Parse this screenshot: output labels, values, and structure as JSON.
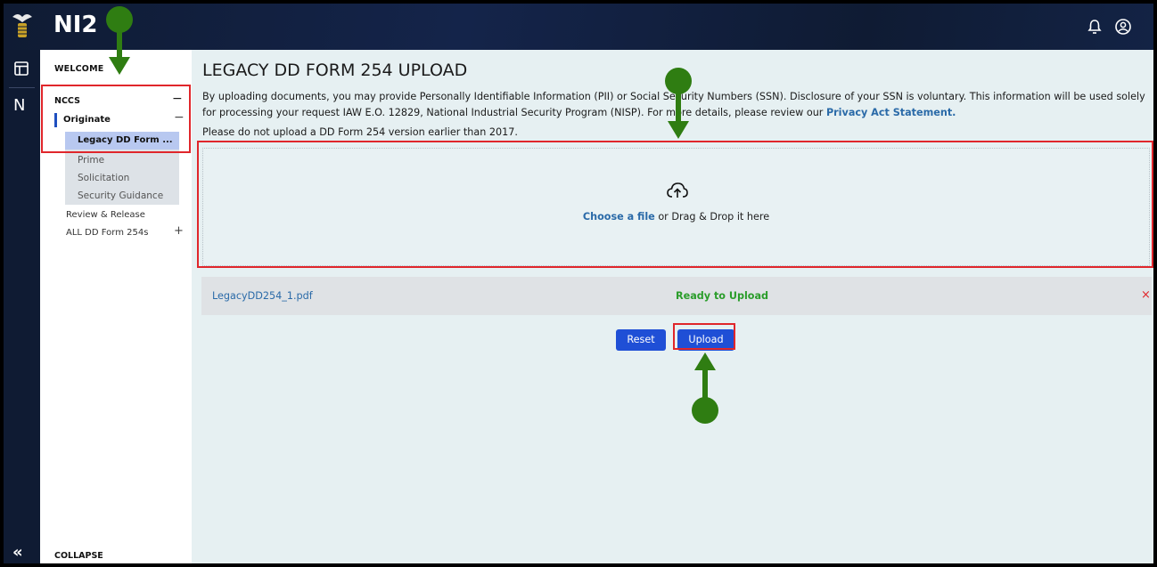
{
  "app": {
    "brand": "NI2"
  },
  "rail": {
    "collapse_glyph": "«",
    "n_label": "N"
  },
  "menu": {
    "welcome": "WELCOME",
    "nccs": "NCCS",
    "nccs_toggle": "−",
    "originate": "Originate",
    "originate_toggle": "−",
    "legacy": "Legacy DD Form ...",
    "sub_items": [
      "Prime",
      "Solicitation",
      "Security Guidance"
    ],
    "review": "Review & Release",
    "all_dd": "ALL DD Form 254s",
    "all_dd_toggle": "+",
    "collapse": "COLLAPSE"
  },
  "main": {
    "title": "LEGACY DD FORM 254 UPLOAD",
    "desc_text": "By uploading documents, you may provide Personally Identifiable Information (PII) or Social Security Numbers (SSN). Disclosure of your SSN is voluntary. This information will be used solely for processing your request IAW E.O. 12829, National Industrial Security Program (NISP). For more details, please review our ",
    "desc_link": "Privacy Act Statement.",
    "note": "Please do not upload a DD Form 254 version earlier than 2017.",
    "dropzone_choose": "Choose a file",
    "dropzone_rest": " or Drag & Drop it here",
    "file_name": "LegacyDD254_1.pdf",
    "file_status": "Ready to Upload",
    "file_remove": "×",
    "reset_label": "Reset",
    "upload_label": "Upload"
  },
  "icons": {
    "logo": "eagle-seal-icon",
    "bell": "bell-icon",
    "account": "account-icon",
    "dashboard": "dashboard-icon",
    "cloud": "cloud-upload-icon"
  },
  "colors": {
    "topbar": "#0f1b33",
    "accent": "#1f4fd6",
    "link": "#2a6aa8",
    "success": "#2a9d2a",
    "danger": "#e0262b",
    "annotation": "#2f7d12"
  }
}
